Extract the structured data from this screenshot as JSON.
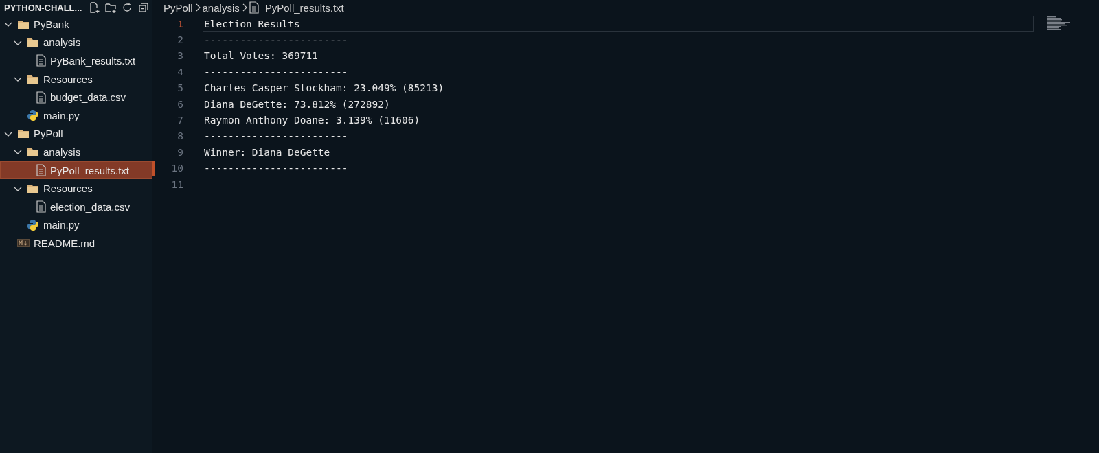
{
  "explorer": {
    "title": "PYTHON-CHALL...",
    "tree": [
      {
        "label": "PyBank",
        "kind": "folder",
        "expanded": true,
        "selected": false,
        "children": [
          {
            "label": "analysis",
            "kind": "folder",
            "expanded": true,
            "selected": false,
            "children": [
              {
                "label": "PyBank_results.txt",
                "kind": "text",
                "selected": false
              }
            ]
          },
          {
            "label": "Resources",
            "kind": "folder",
            "expanded": true,
            "selected": false,
            "children": [
              {
                "label": "budget_data.csv",
                "kind": "text",
                "selected": false
              }
            ]
          },
          {
            "label": "main.py",
            "kind": "python",
            "selected": false
          }
        ]
      },
      {
        "label": "PyPoll",
        "kind": "folder",
        "expanded": true,
        "selected": false,
        "children": [
          {
            "label": "analysis",
            "kind": "folder",
            "expanded": true,
            "selected": false,
            "children": [
              {
                "label": "PyPoll_results.txt",
                "kind": "text",
                "selected": true
              }
            ]
          },
          {
            "label": "Resources",
            "kind": "folder",
            "expanded": true,
            "selected": false,
            "children": [
              {
                "label": "election_data.csv",
                "kind": "text",
                "selected": false
              }
            ]
          },
          {
            "label": "main.py",
            "kind": "python",
            "selected": false
          }
        ]
      },
      {
        "label": "README.md",
        "kind": "markdown",
        "selected": false
      }
    ]
  },
  "breadcrumbs": [
    "PyPoll",
    "analysis",
    "PyPoll_results.txt"
  ],
  "editor": {
    "lines": [
      {
        "number": "1",
        "text": "Election Results",
        "selected": true,
        "modified": false
      },
      {
        "number": "2",
        "text": "------------------------",
        "selected": false,
        "modified": false
      },
      {
        "number": "3",
        "text": "Total Votes: 369711",
        "selected": false,
        "modified": false
      },
      {
        "number": "4",
        "text": "------------------------",
        "selected": false,
        "modified": false
      },
      {
        "number": "5",
        "text": "Charles Casper Stockham: 23.049% (85213)",
        "selected": false,
        "modified": false
      },
      {
        "number": "6",
        "text": "Diana DeGette: 73.812% (272892)",
        "selected": false,
        "modified": false
      },
      {
        "number": "7",
        "text": "Raymon Anthony Doane: 3.139% (11606)",
        "selected": false,
        "modified": false
      },
      {
        "number": "8",
        "text": "------------------------",
        "selected": false,
        "modified": false
      },
      {
        "number": "9",
        "text": "Winner: Diana DeGette",
        "selected": false,
        "modified": false
      },
      {
        "number": "10",
        "text": "------------------------",
        "selected": false,
        "modified": true
      },
      {
        "number": "11",
        "selected": false,
        "modified": false
      }
    ]
  }
}
